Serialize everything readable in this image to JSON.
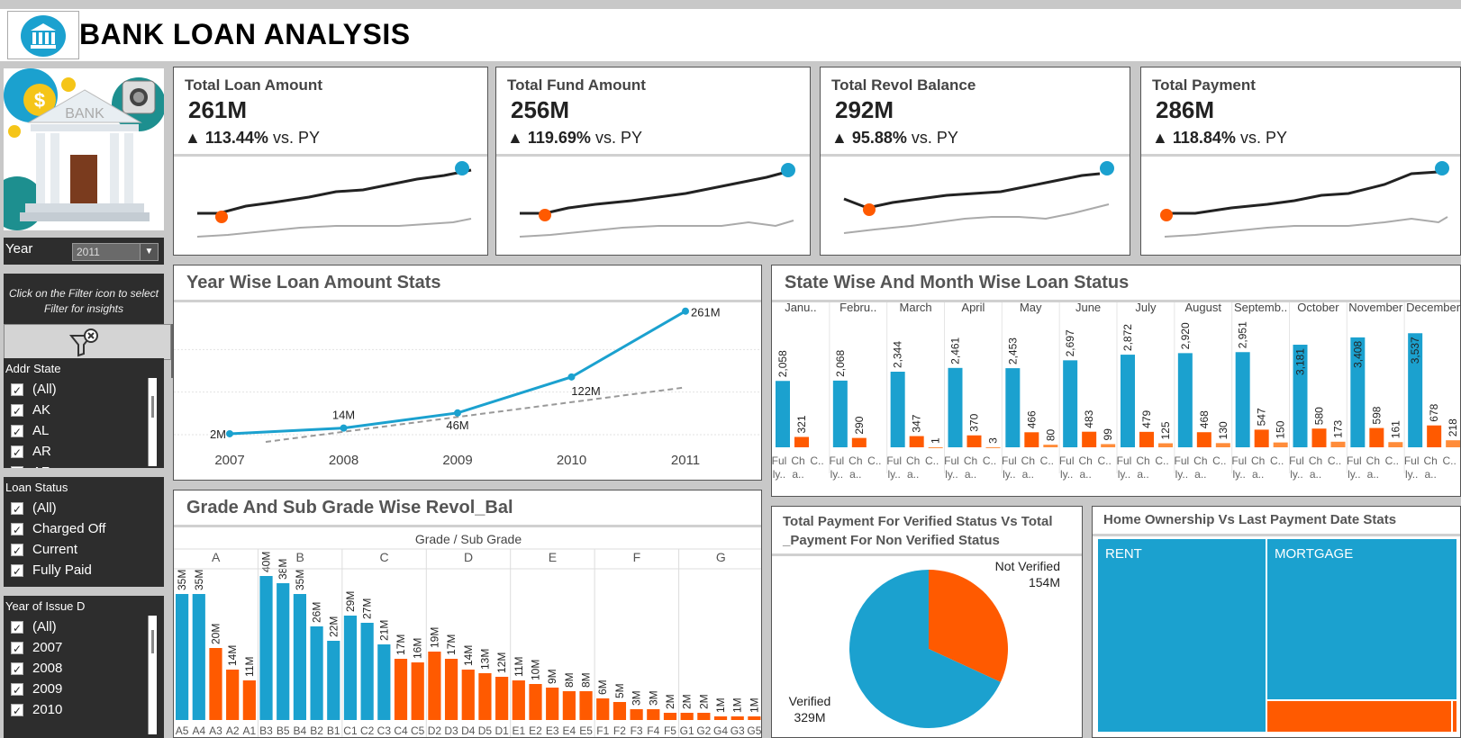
{
  "header": {
    "title": "BANK LOAN ANALYSIS",
    "logo_icon": "bank-building-icon"
  },
  "bank_image": {
    "label": "BANK"
  },
  "year_filter": {
    "label": "Year",
    "value": "2011"
  },
  "filter_hint": "Click on the Filter icon to select Filter for insights",
  "filters": {
    "addr_state": {
      "title": "Addr State",
      "items": [
        "(All)",
        "AK",
        "AL",
        "AR",
        "AZ"
      ]
    },
    "loan_status": {
      "title": "Loan Status",
      "items": [
        "(All)",
        "Charged Off",
        "Current",
        "Fully Paid"
      ]
    },
    "year_issue": {
      "title": "Year of Issue D",
      "items": [
        "(All)",
        "2007",
        "2008",
        "2009",
        "2010"
      ]
    }
  },
  "kpis": [
    {
      "title": "Total Loan Amount",
      "value": "261M",
      "delta": "113.44%",
      "suffix": "vs. PY"
    },
    {
      "title": "Total Fund Amount",
      "value": "256M",
      "delta": "119.69%",
      "suffix": "vs. PY"
    },
    {
      "title": "Total Revol Balance",
      "value": "292M",
      "delta": "95.88%",
      "suffix": "vs. PY"
    },
    {
      "title": "Total Payment",
      "value": "286M",
      "delta": "118.84%",
      "suffix": "vs. PY"
    }
  ],
  "colors": {
    "blue": "#1ba1cf",
    "orange": "#ff5a00",
    "light_orange": "#ff8c3a"
  },
  "chart_data": [
    {
      "id": "year_wise",
      "type": "line",
      "title": "Year Wise Loan Amount Stats",
      "x": [
        "2007",
        "2008",
        "2009",
        "2010",
        "2011"
      ],
      "values": [
        2,
        14,
        46,
        122,
        261
      ],
      "labels": [
        "2M",
        "14M",
        "46M",
        "122M",
        "261M"
      ],
      "trend_line": true
    },
    {
      "id": "state_month",
      "type": "bar",
      "title": "State Wise And Month Wise Loan Status",
      "categories": [
        "Janu..",
        "Febru..",
        "March",
        "April",
        "May",
        "June",
        "July",
        "August",
        "Septemb..",
        "October",
        "November",
        "December"
      ],
      "sub_labels": [
        "Ful ly..",
        "Ch a..",
        "C.."
      ],
      "series": [
        {
          "values": [
            2058,
            2068,
            2344,
            2461,
            2453,
            2697,
            2872,
            2920,
            2951,
            3181,
            3408,
            3537
          ]
        },
        {
          "values": [
            321,
            290,
            347,
            370,
            466,
            483,
            479,
            468,
            547,
            580,
            598,
            678
          ]
        },
        {
          "values": [
            null,
            null,
            1,
            3,
            80,
            99,
            125,
            130,
            150,
            173,
            161,
            218
          ]
        }
      ]
    },
    {
      "id": "grade_revol",
      "type": "bar",
      "title": "Grade And Sub Grade Wise Revol_Bal",
      "header": "Grade / Sub Grade",
      "groups": [
        {
          "grade": "A",
          "subs": [
            "A5",
            "A4",
            "A3",
            "A2",
            "A1"
          ],
          "values": [
            35,
            35,
            20,
            14,
            11
          ],
          "labels": [
            "35M",
            "35M",
            "20M",
            "14M",
            "11M"
          ]
        },
        {
          "grade": "B",
          "subs": [
            "B3",
            "B5",
            "B4",
            "B2",
            "B1"
          ],
          "values": [
            40,
            38,
            35,
            26,
            22
          ],
          "labels": [
            "40M",
            "38M",
            "35M",
            "26M",
            "22M"
          ]
        },
        {
          "grade": "C",
          "subs": [
            "C1",
            "C2",
            "C3",
            "C4",
            "C5"
          ],
          "values": [
            29,
            27,
            21,
            17,
            16
          ],
          "labels": [
            "29M",
            "27M",
            "21M",
            "17M",
            "16M"
          ]
        },
        {
          "grade": "D",
          "subs": [
            "D2",
            "D3",
            "D4",
            "D5",
            "D1"
          ],
          "values": [
            19,
            17,
            14,
            13,
            12
          ],
          "labels": [
            "19M",
            "17M",
            "14M",
            "13M",
            "12M"
          ]
        },
        {
          "grade": "E",
          "subs": [
            "E1",
            "E2",
            "E3",
            "E4",
            "E5"
          ],
          "values": [
            11,
            10,
            9,
            8,
            8
          ],
          "labels": [
            "11M",
            "10M",
            "9M",
            "8M",
            "8M"
          ]
        },
        {
          "grade": "F",
          "subs": [
            "F1",
            "F2",
            "F3",
            "F4",
            "F5"
          ],
          "values": [
            6,
            5,
            3,
            3,
            2
          ],
          "labels": [
            "6M",
            "5M",
            "3M",
            "3M",
            "2M"
          ]
        },
        {
          "grade": "G",
          "subs": [
            "G1",
            "G2",
            "G4",
            "G3",
            "G5"
          ],
          "values": [
            2,
            2,
            1,
            1,
            1
          ],
          "labels": [
            "2M",
            "2M",
            "1M",
            "1M",
            "1M"
          ]
        }
      ]
    },
    {
      "id": "verified_pie",
      "type": "pie",
      "title": "Total Payment For Verified Status Vs Total _Payment For Non Verified Status",
      "slices": [
        {
          "label": "Not Verified",
          "value": 154,
          "value_label": "154M"
        },
        {
          "label": "Verified",
          "value": 329,
          "value_label": "329M"
        }
      ]
    },
    {
      "id": "home_treemap",
      "type": "heatmap",
      "title": "Home Ownership Vs Last Payment Date Stats",
      "cells": [
        {
          "label": "RENT"
        },
        {
          "label": "MORTGAGE"
        }
      ]
    }
  ]
}
